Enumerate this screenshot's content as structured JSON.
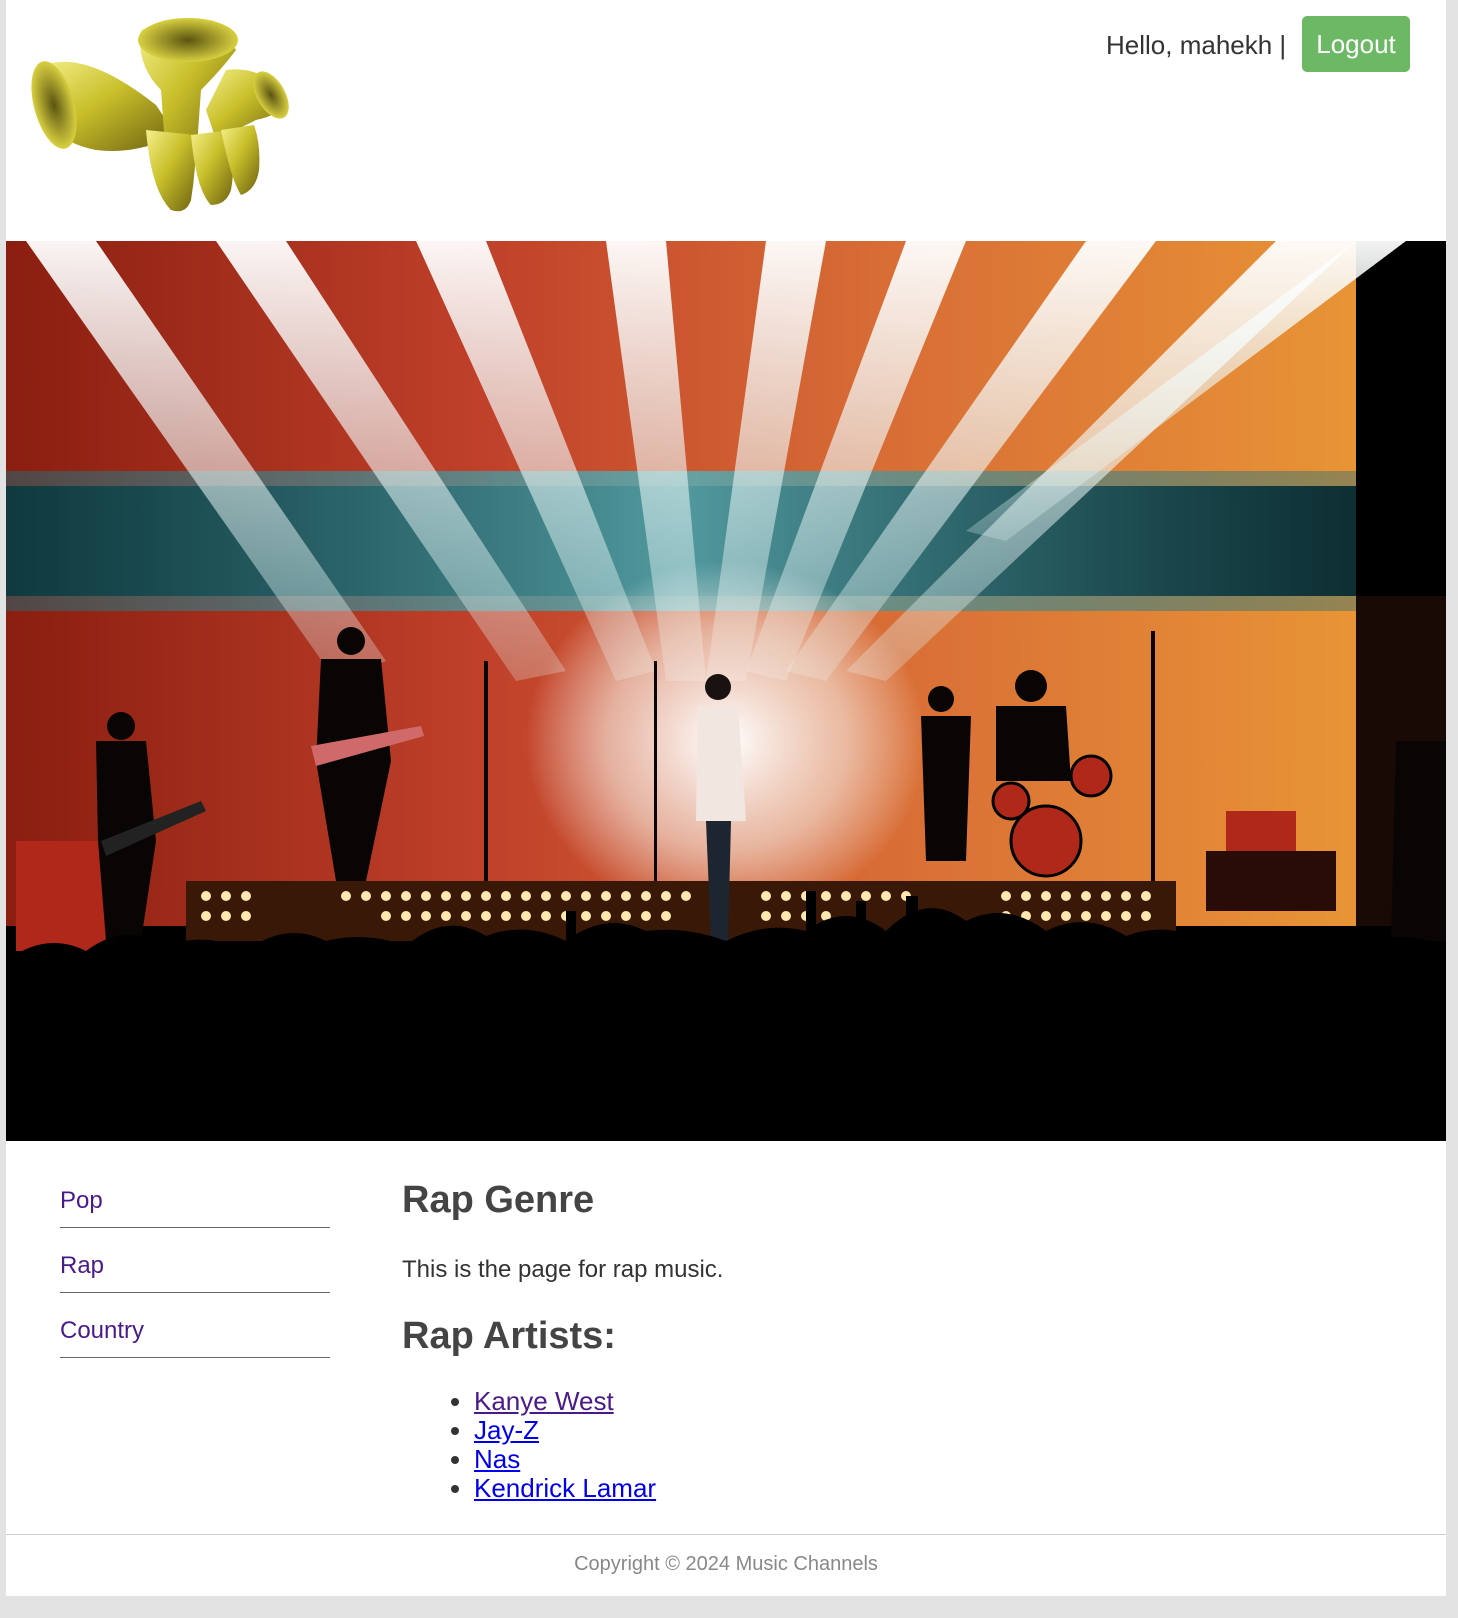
{
  "header": {
    "greeting": "Hello, mahekh |",
    "logout_label": "Logout",
    "logo_icon": "horn-logo-icon"
  },
  "hero": {
    "image": "concert-stage-photo"
  },
  "sidebar": {
    "items": [
      {
        "label": "Pop"
      },
      {
        "label": "Rap"
      },
      {
        "label": "Country"
      }
    ]
  },
  "main": {
    "title": "Rap Genre",
    "description": "This is the page for rap music.",
    "artists_heading": "Rap Artists:",
    "artists": [
      {
        "name": "Kanye West",
        "visited": true
      },
      {
        "name": "Jay-Z",
        "visited": false
      },
      {
        "name": "Nas",
        "visited": false
      },
      {
        "name": "Kendrick Lamar",
        "visited": false
      }
    ]
  },
  "footer": {
    "copyright": "Copyright © 2024 Music Channels"
  },
  "colors": {
    "logout_button": "#6cb864",
    "nav_link": "#4b1a8a",
    "link": "#0000ee",
    "page_background": "#e3e3e3"
  }
}
